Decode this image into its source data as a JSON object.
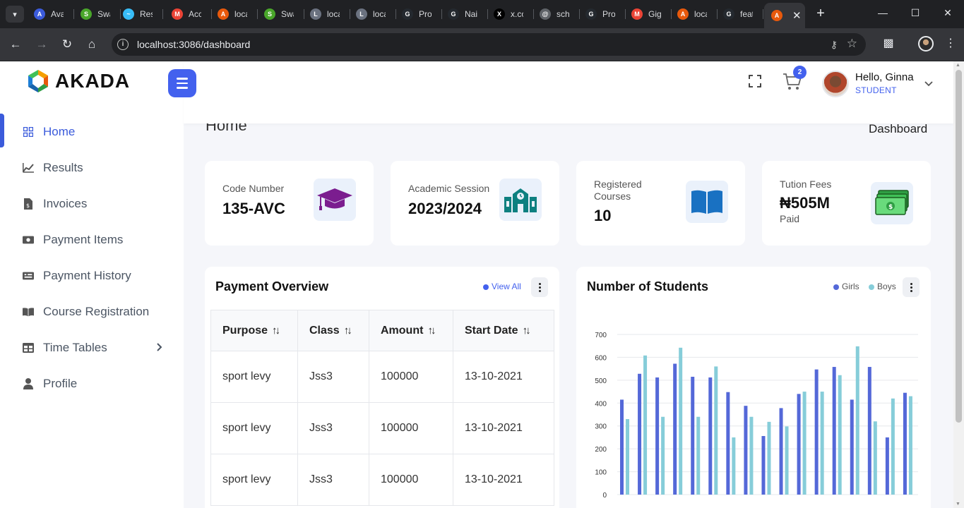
{
  "browser": {
    "tabs": [
      {
        "title": "Ava",
        "fav": "A",
        "color": "#3b5bdb"
      },
      {
        "title": "Swa",
        "fav": "S",
        "color": "#49a62a"
      },
      {
        "title": "Res",
        "fav": "~",
        "color": "#38bdf8"
      },
      {
        "title": "Acc",
        "fav": "M",
        "color": "#ea4335"
      },
      {
        "title": "loca",
        "fav": "A",
        "color": "#e8590c"
      },
      {
        "title": "Swa",
        "fav": "S",
        "color": "#49a62a"
      },
      {
        "title": "loca",
        "fav": "L",
        "color": "#6b7280"
      },
      {
        "title": "loca",
        "fav": "L",
        "color": "#6b7280"
      },
      {
        "title": "Pro",
        "fav": "G",
        "color": "#24292f"
      },
      {
        "title": "Nai",
        "fav": "G",
        "color": "#24292f"
      },
      {
        "title": "x.co",
        "fav": "X",
        "color": "#000000"
      },
      {
        "title": "sch",
        "fav": "@",
        "color": "#5f6368"
      },
      {
        "title": "Pro",
        "fav": "G",
        "color": "#24292f"
      },
      {
        "title": "Gig",
        "fav": "M",
        "color": "#ea4335"
      },
      {
        "title": "loca",
        "fav": "A",
        "color": "#e8590c"
      },
      {
        "title": "feat",
        "fav": "G",
        "color": "#24292f"
      }
    ],
    "url": "localhost:3086/dashboard"
  },
  "sidebar": {
    "brand": "AKADA",
    "items": [
      {
        "label": "Home",
        "icon": "grid-icon"
      },
      {
        "label": "Results",
        "icon": "chart-line-icon"
      },
      {
        "label": "Invoices",
        "icon": "invoice-icon"
      },
      {
        "label": "Payment Items",
        "icon": "money-icon"
      },
      {
        "label": "Payment History",
        "icon": "receipt-icon"
      },
      {
        "label": "Course Registration",
        "icon": "book-open-icon"
      },
      {
        "label": "Time Tables",
        "icon": "table-icon"
      },
      {
        "label": "Profile",
        "icon": "user-icon"
      }
    ]
  },
  "header": {
    "cart_count": "2",
    "greeting": "Hello, Ginna",
    "role": "STUDENT"
  },
  "page": {
    "title": "Home",
    "breadcrumb": "Dashboard"
  },
  "stats": [
    {
      "label": "Code Number",
      "value": "135-AVC",
      "sub": ""
    },
    {
      "label": "Academic Session",
      "value": "2023/2024",
      "sub": ""
    },
    {
      "label": "Registered Courses",
      "value": "10",
      "sub": ""
    },
    {
      "label": "Tution Fees",
      "value": "₦505M",
      "sub": "Paid"
    }
  ],
  "payment_overview": {
    "title": "Payment Overview",
    "view_all": "View All",
    "columns": [
      "Purpose",
      "Class",
      "Amount",
      "Start Date"
    ],
    "rows": [
      [
        "sport levy",
        "Jss3",
        "100000",
        "13-10-2021"
      ],
      [
        "sport levy",
        "Jss3",
        "100000",
        "13-10-2021"
      ],
      [
        "sport levy",
        "Jss3",
        "100000",
        "13-10-2021"
      ]
    ]
  },
  "students": {
    "title": "Number of Students",
    "legend_girls": "Girls",
    "legend_boys": "Boys"
  },
  "colors": {
    "accent": "#4361ee",
    "girls": "#5468d8",
    "boys": "#86cdd9"
  },
  "chart_data": {
    "type": "bar",
    "title": "Number of Students",
    "ylim": [
      0,
      700
    ],
    "yticks": [
      "0",
      "100",
      "200",
      "300",
      "400",
      "500",
      "600",
      "700"
    ],
    "grid": true,
    "legend": "top-right",
    "series": [
      {
        "name": "Girls",
        "values": [
          415,
          528,
          512,
          572,
          515,
          512,
          448,
          388,
          256,
          378,
          440,
          547,
          558,
          415,
          558,
          250,
          445
        ]
      },
      {
        "name": "Boys",
        "values": [
          330,
          608,
          340,
          642,
          340,
          560,
          250,
          340,
          318,
          298,
          450,
          450,
          522,
          648,
          320,
          420,
          430
        ]
      }
    ]
  }
}
